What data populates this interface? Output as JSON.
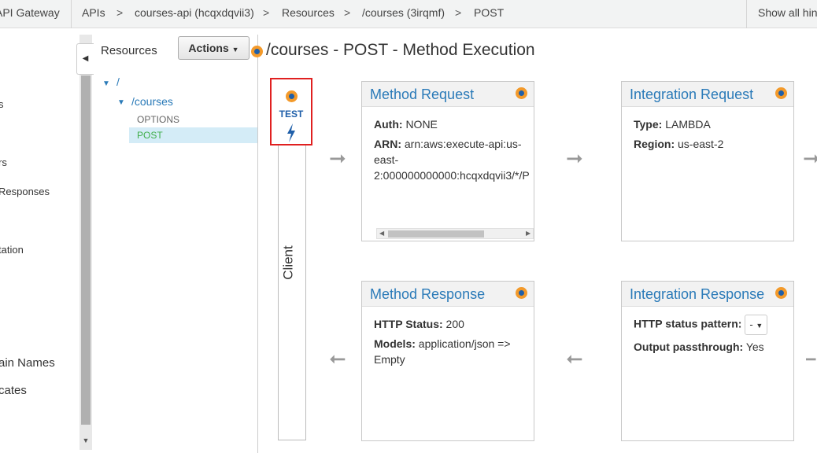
{
  "breadcrumb": {
    "service": "API Gateway",
    "items": [
      "APIs",
      "courses-api (hcqxdqvii3)",
      "Resources",
      "/courses (3irqmf)",
      "POST"
    ],
    "separator": ">",
    "hints": "Show all hints"
  },
  "leftnav": {
    "items": [
      "s",
      "rs",
      "Responses",
      "tation",
      "ain Names",
      "cates"
    ]
  },
  "resources": {
    "title": "Resources",
    "actions_label": "Actions",
    "tree": {
      "root": "/",
      "courses": "/courses",
      "methods": [
        "OPTIONS",
        "POST"
      ]
    }
  },
  "main": {
    "title": "/courses - POST - Method Execution",
    "test_label": "TEST",
    "client_label": "Client",
    "method_request": {
      "title": "Method Request",
      "auth_key": "Auth:",
      "auth_value": "NONE",
      "arn_key": "ARN:",
      "arn_lines": [
        "arn:aws:execute-api:us-",
        "east-",
        "2:000000000000:hcqxdqvii3/*/P"
      ]
    },
    "integration_request": {
      "title": "Integration Request",
      "type_key": "Type:",
      "type_value": "LAMBDA",
      "region_key": "Region:",
      "region_value": "us-east-2"
    },
    "method_response": {
      "title": "Method Response",
      "status_key": "HTTP Status:",
      "status_value": "200",
      "models_key": "Models:",
      "models_value": "application/json =>",
      "models_value2": "Empty"
    },
    "integration_response": {
      "title": "Integration Response",
      "pattern_key": "HTTP status pattern:",
      "pattern_value": "-",
      "passthrough_key": "Output passthrough:",
      "passthrough_value": "Yes"
    }
  },
  "colors": {
    "accent_blue": "#2a7ab8",
    "orange": "#f39a2b",
    "selected_method": "#3fae49",
    "highlight_border": "#e02020"
  }
}
